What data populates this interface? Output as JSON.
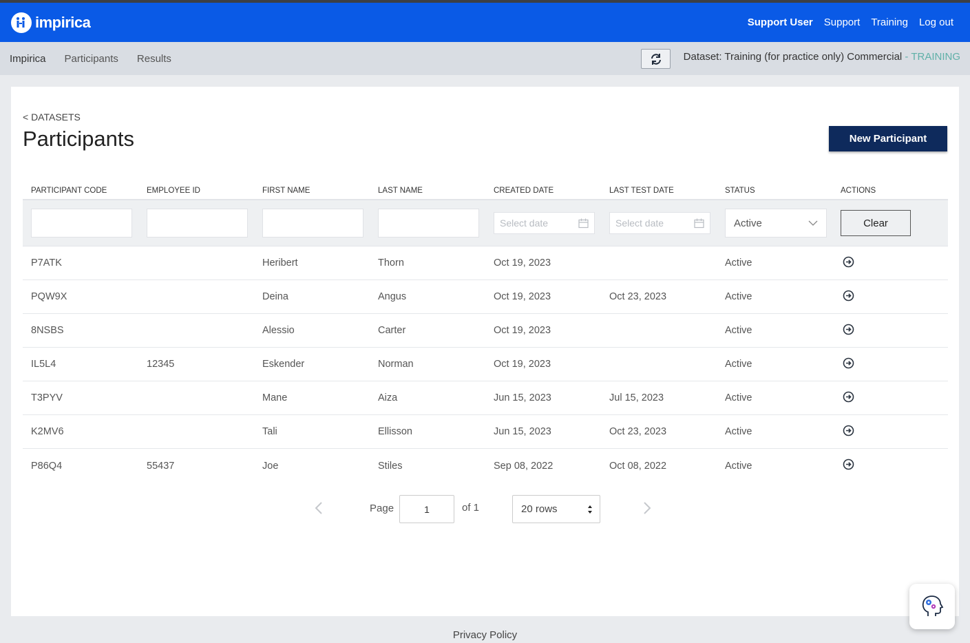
{
  "header": {
    "logo_text": "impirica",
    "links": {
      "user": "Support User",
      "support": "Support",
      "training": "Training",
      "logout": "Log out"
    }
  },
  "subnav": {
    "brand": "Impirica",
    "items": [
      "Participants",
      "Results"
    ],
    "dataset_label": "Dataset: Training (for practice only) Commercial",
    "dataset_sep": " - ",
    "dataset_tag": "TRAINING"
  },
  "page": {
    "breadcrumb": "< DATASETS",
    "title": "Participants",
    "new_button": "New Participant"
  },
  "table": {
    "columns": [
      "PARTICIPANT CODE",
      "EMPLOYEE ID",
      "FIRST NAME",
      "LAST NAME",
      "CREATED DATE",
      "LAST TEST DATE",
      "STATUS",
      "ACTIONS"
    ],
    "filters": {
      "created_placeholder": "Select date",
      "last_test_placeholder": "Select date",
      "status_value": "Active",
      "clear_label": "Clear"
    },
    "rows": [
      {
        "code": "P7ATK",
        "employee_id": "",
        "first": "Heribert",
        "last": "Thorn",
        "created": "Oct 19, 2023",
        "last_test": "",
        "status": "Active"
      },
      {
        "code": "PQW9X",
        "employee_id": "",
        "first": "Deina",
        "last": "Angus",
        "created": "Oct 19, 2023",
        "last_test": "Oct 23, 2023",
        "status": "Active"
      },
      {
        "code": "8NSBS",
        "employee_id": "",
        "first": "Alessio",
        "last": "Carter",
        "created": "Oct 19, 2023",
        "last_test": "",
        "status": "Active"
      },
      {
        "code": "IL5L4",
        "employee_id": "12345",
        "first": "Eskender",
        "last": "Norman",
        "created": "Oct 19, 2023",
        "last_test": "",
        "status": "Active"
      },
      {
        "code": "T3PYV",
        "employee_id": "",
        "first": "Mane",
        "last": "Aiza",
        "created": "Jun 15, 2023",
        "last_test": "Jul 15, 2023",
        "status": "Active"
      },
      {
        "code": "K2MV6",
        "employee_id": "",
        "first": "Tali",
        "last": "Ellisson",
        "created": "Jun 15, 2023",
        "last_test": "Oct 23, 2023",
        "status": "Active"
      },
      {
        "code": "P86Q4",
        "employee_id": "55437",
        "first": "Joe",
        "last": "Stiles",
        "created": "Sep 08, 2022",
        "last_test": "Oct 08, 2022",
        "status": "Active"
      }
    ]
  },
  "pagination": {
    "page_label": "Page",
    "page_value": "1",
    "of_label": "of 1",
    "rows_label": "20 rows"
  },
  "footer": {
    "privacy": "Privacy Policy"
  },
  "colors": {
    "primary": "#0a5ae6",
    "navy_button": "#0e2a5c",
    "training_tag": "#5fb0a8"
  }
}
